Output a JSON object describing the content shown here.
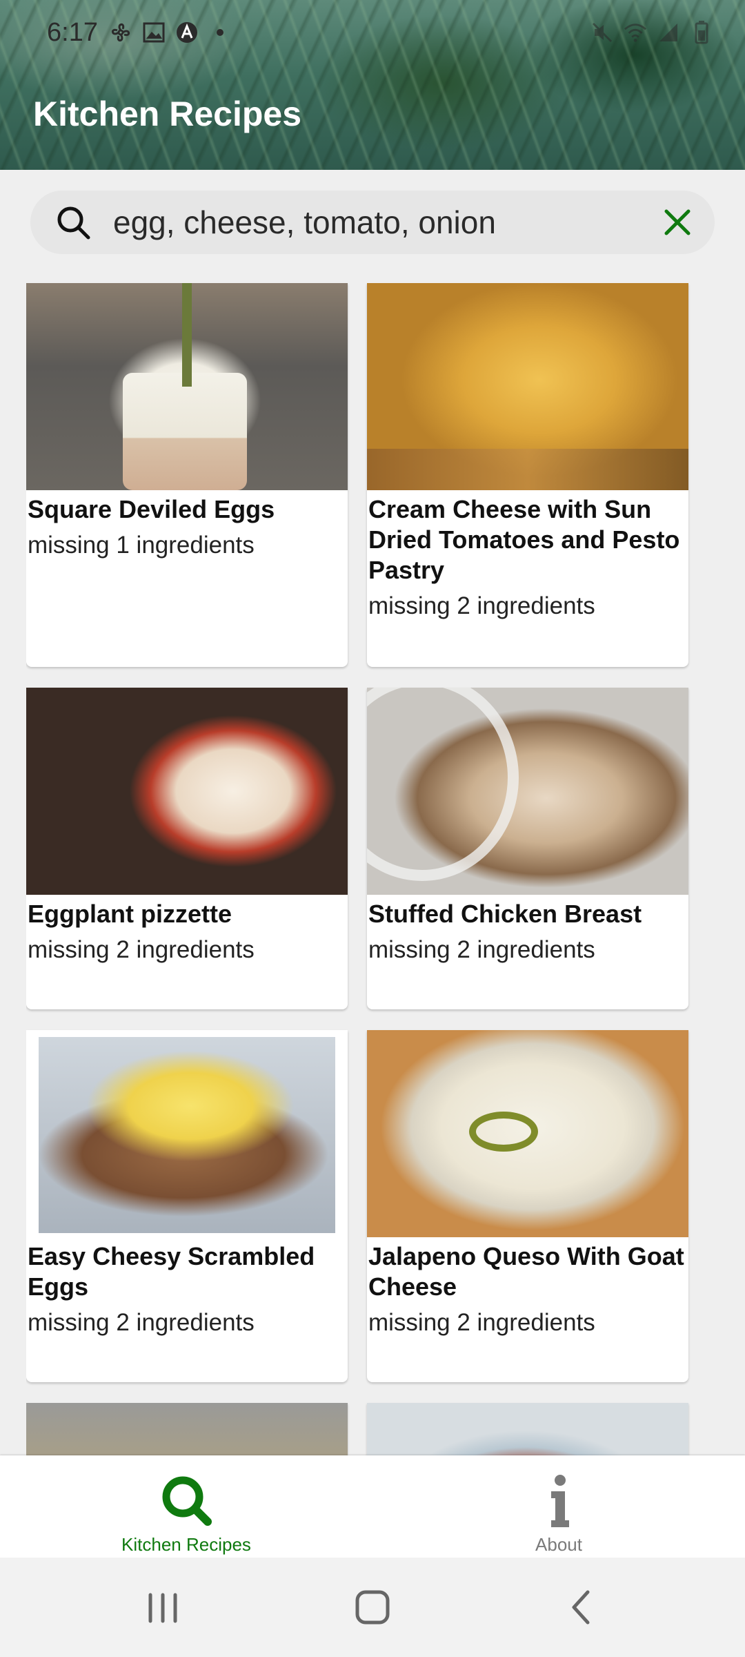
{
  "status_bar": {
    "time": "6:17"
  },
  "header": {
    "title": "Kitchen Recipes"
  },
  "search": {
    "value": "egg, cheese, tomato, onion"
  },
  "recipes": [
    {
      "title": "Square Deviled Eggs",
      "missing": "missing 1 ingredients"
    },
    {
      "title": "Cream Cheese with Sun Dried Tomatoes and Pesto Pastry",
      "missing": "missing 2 ingredients"
    },
    {
      "title": "Eggplant pizzette",
      "missing": "missing 2 ingredients"
    },
    {
      "title": "Stuffed Chicken Breast",
      "missing": "missing 2 ingredients"
    },
    {
      "title": "Easy Cheesy Scrambled Eggs",
      "missing": "missing 2 ingredients"
    },
    {
      "title": "Jalapeno Queso With Goat Cheese",
      "missing": "missing 2 ingredients"
    }
  ],
  "bottom_nav": {
    "items": [
      {
        "label": "Kitchen Recipes",
        "icon": "search-icon",
        "active": true
      },
      {
        "label": "About",
        "icon": "info-icon",
        "active": false
      }
    ]
  },
  "colors": {
    "accent": "#0f7a0f",
    "inactive": "#7a7a7a",
    "background": "#efefef"
  }
}
